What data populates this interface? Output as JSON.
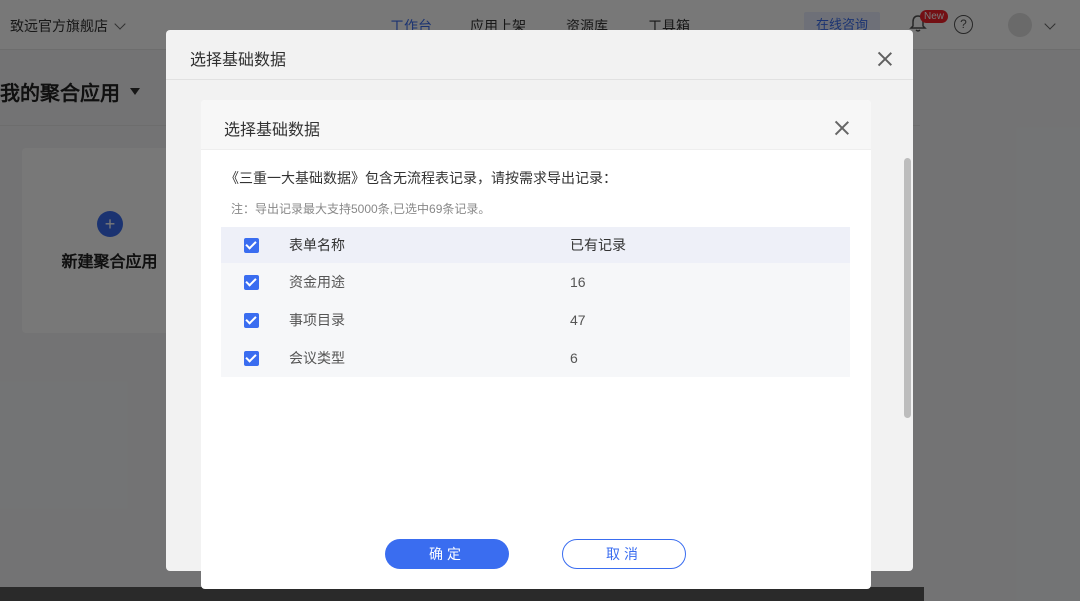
{
  "topbar": {
    "store_name": "致远官方旗舰店",
    "nav": [
      "工作台",
      "应用上架",
      "资源库",
      "工具箱"
    ],
    "consult": "在线咨询",
    "badge": "New",
    "help": "?"
  },
  "page": {
    "title": "我的聚合应用",
    "new_card_label": "新建聚合应用"
  },
  "outer_dialog": {
    "title": "选择基础数据"
  },
  "dialog": {
    "title": "选择基础数据",
    "description": "《三重一大基础数据》包含无流程表记录，请按需求导出记录：",
    "note": "注：导出记录最大支持5000条,已选中69条记录。",
    "table": {
      "headers": [
        "表单名称",
        "已有记录"
      ],
      "rows": [
        {
          "name": "资金用途",
          "count": "16"
        },
        {
          "name": "事项目录",
          "count": "47"
        },
        {
          "name": "会议类型",
          "count": "6"
        }
      ]
    },
    "confirm": "确定",
    "cancel": "取消"
  },
  "colors": {
    "accent": "#3a6df0"
  }
}
